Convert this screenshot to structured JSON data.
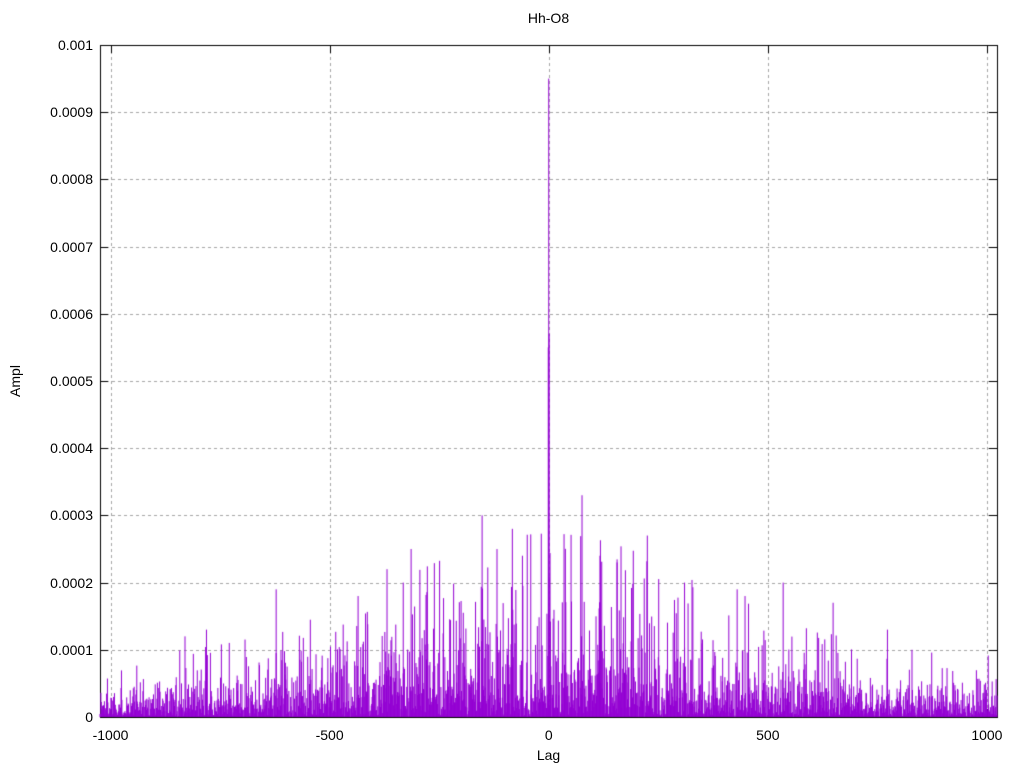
{
  "page": {
    "background_color": "#ffffff",
    "text_color": "#000000"
  },
  "chart_data": {
    "type": "line",
    "plot_style": "impulses",
    "title": "Hh-O8",
    "xlabel": "Lag",
    "ylabel": "Ampl",
    "xlim": [
      -1024,
      1023
    ],
    "ylim": [
      0,
      0.001
    ],
    "xtick_values": [
      -1000,
      -500,
      0,
      500,
      1000
    ],
    "xtick_labels": [
      "-1000",
      "-500",
      "0",
      "500",
      "1000"
    ],
    "ytick_values": [
      0,
      0.0001,
      0.0002,
      0.0003,
      0.0004,
      0.0005,
      0.0006,
      0.0007,
      0.0008,
      0.0009,
      0.001
    ],
    "ytick_labels": [
      "0",
      "0.0001",
      "0.0002",
      "0.0003",
      "0.0004",
      "0.0005",
      "0.0006",
      "0.0007",
      "0.0008",
      "0.0009",
      "0.001"
    ],
    "grid": true,
    "legend": "none",
    "line_color": "#9400d3",
    "grid_color": "#a6a6a6",
    "axis_color": "#000000",
    "n_points": 2048,
    "noise_envelope": {
      "seed": 1337,
      "floor": 2.1e-05,
      "amp": 4.4e-05,
      "sigma": 500,
      "tail_cap": 4.2,
      "description": "positive noise floor rising from ~0.00005 at |lag|=1000 to ~0.00015 near lag 0"
    },
    "peaks": [
      {
        "lag": -830,
        "ampl": 0.00012
      },
      {
        "lag": -781,
        "ampl": 0.00013
      },
      {
        "lag": -622,
        "ampl": 0.00019
      },
      {
        "lag": -435,
        "ampl": 0.00018
      },
      {
        "lag": -369,
        "ampl": 0.00022
      },
      {
        "lag": -332,
        "ampl": 0.0002
      },
      {
        "lag": -314,
        "ampl": 0.00025
      },
      {
        "lag": -152,
        "ampl": 0.0003
      },
      {
        "lag": -83,
        "ampl": 0.00028
      },
      {
        "lag": -60,
        "ampl": 0.00024
      },
      {
        "lag": -1,
        "ampl": 0.00055
      },
      {
        "lag": 0,
        "ampl": 0.00095
      },
      {
        "lag": 1,
        "ampl": 0.00057
      },
      {
        "lag": 76,
        "ampl": 0.00033
      },
      {
        "lag": 117,
        "ampl": 0.00024
      },
      {
        "lag": 156,
        "ampl": 0.00023
      },
      {
        "lag": 225,
        "ampl": 0.00027
      },
      {
        "lag": 310,
        "ampl": 0.0002
      },
      {
        "lag": 430,
        "ampl": 0.00019
      },
      {
        "lag": 448,
        "ampl": 0.00018
      },
      {
        "lag": 535,
        "ampl": 0.0002
      },
      {
        "lag": 649,
        "ampl": 0.00017
      },
      {
        "lag": 773,
        "ampl": 0.00013
      }
    ]
  }
}
